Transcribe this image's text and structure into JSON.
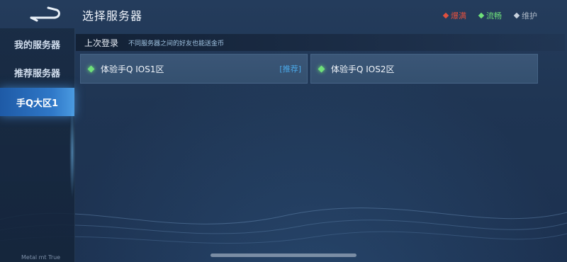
{
  "header": {
    "title": "选择服务器"
  },
  "legend": [
    {
      "label": "爆满",
      "color": "#e0503f"
    },
    {
      "label": "流畅",
      "color": "#6fe07a"
    },
    {
      "label": "维护",
      "color": "#c8d2de"
    }
  ],
  "sidebar": {
    "items": [
      {
        "label": "我的服务器"
      },
      {
        "label": "推荐服务器"
      },
      {
        "label": "手Q大区1"
      }
    ],
    "footer": "Metal mt True"
  },
  "banner": {
    "title": "上次登录",
    "note": "不同服务器之间的好友也能送金币"
  },
  "servers": [
    {
      "name": "体验手Q IOS1区",
      "tag": "[推荐]",
      "status_color": "#6fe07a"
    },
    {
      "name": "体验手Q IOS2区",
      "tag": "",
      "status_color": "#6fe07a"
    }
  ]
}
